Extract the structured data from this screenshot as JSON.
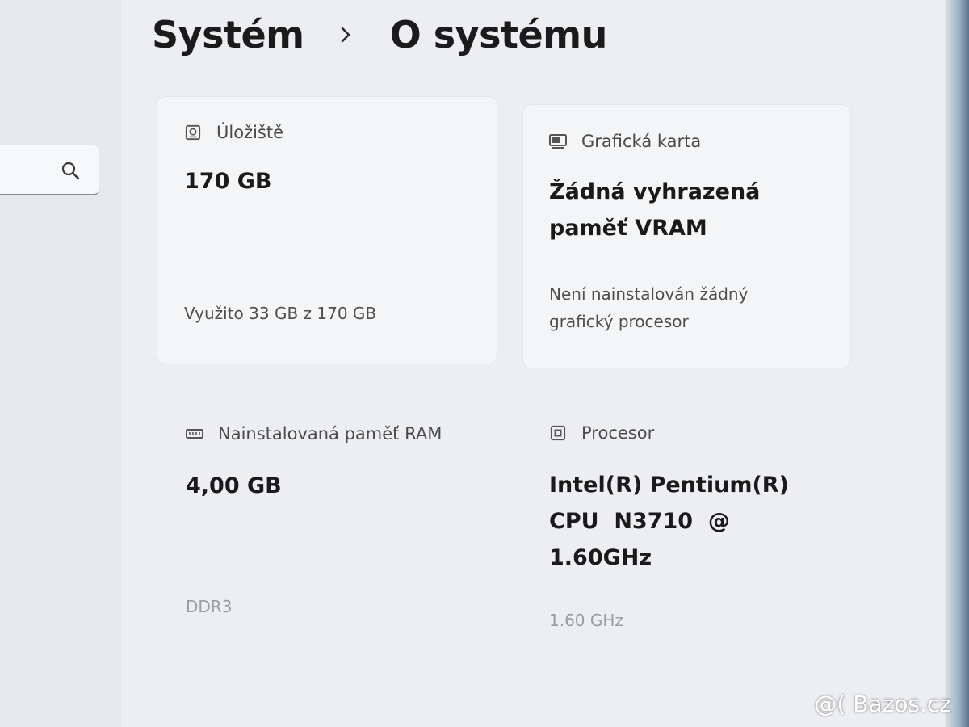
{
  "breadcrumb": {
    "parent": "Systém",
    "current": "O systému"
  },
  "search": {
    "icon": "search-icon"
  },
  "specs": {
    "storage": {
      "label": "Úložiště",
      "value": "170 GB",
      "usage": "Využito 33 GB z 170 GB",
      "icon": "storage-icon"
    },
    "graphics": {
      "label": "Grafická karta",
      "value_line1": "Žádná vyhrazená",
      "value_line2": "paměť VRAM",
      "detail_line1": "Není nainstalován žádný",
      "detail_line2": "grafický procesor",
      "icon": "graphics-card-icon"
    },
    "ram": {
      "label": "Nainstalovaná paměť RAM",
      "value": "4,00 GB",
      "detail": "DDR3",
      "icon": "memory-icon"
    },
    "cpu": {
      "label": "Procesor",
      "value_line1": "Intel(R) Pentium(R)",
      "value_line2": "CPU  N3710  @",
      "value_line3": "1.60GHz",
      "detail": "1.60 GHz",
      "icon": "processor-icon"
    }
  },
  "watermark": "@( Bazos.cz"
}
